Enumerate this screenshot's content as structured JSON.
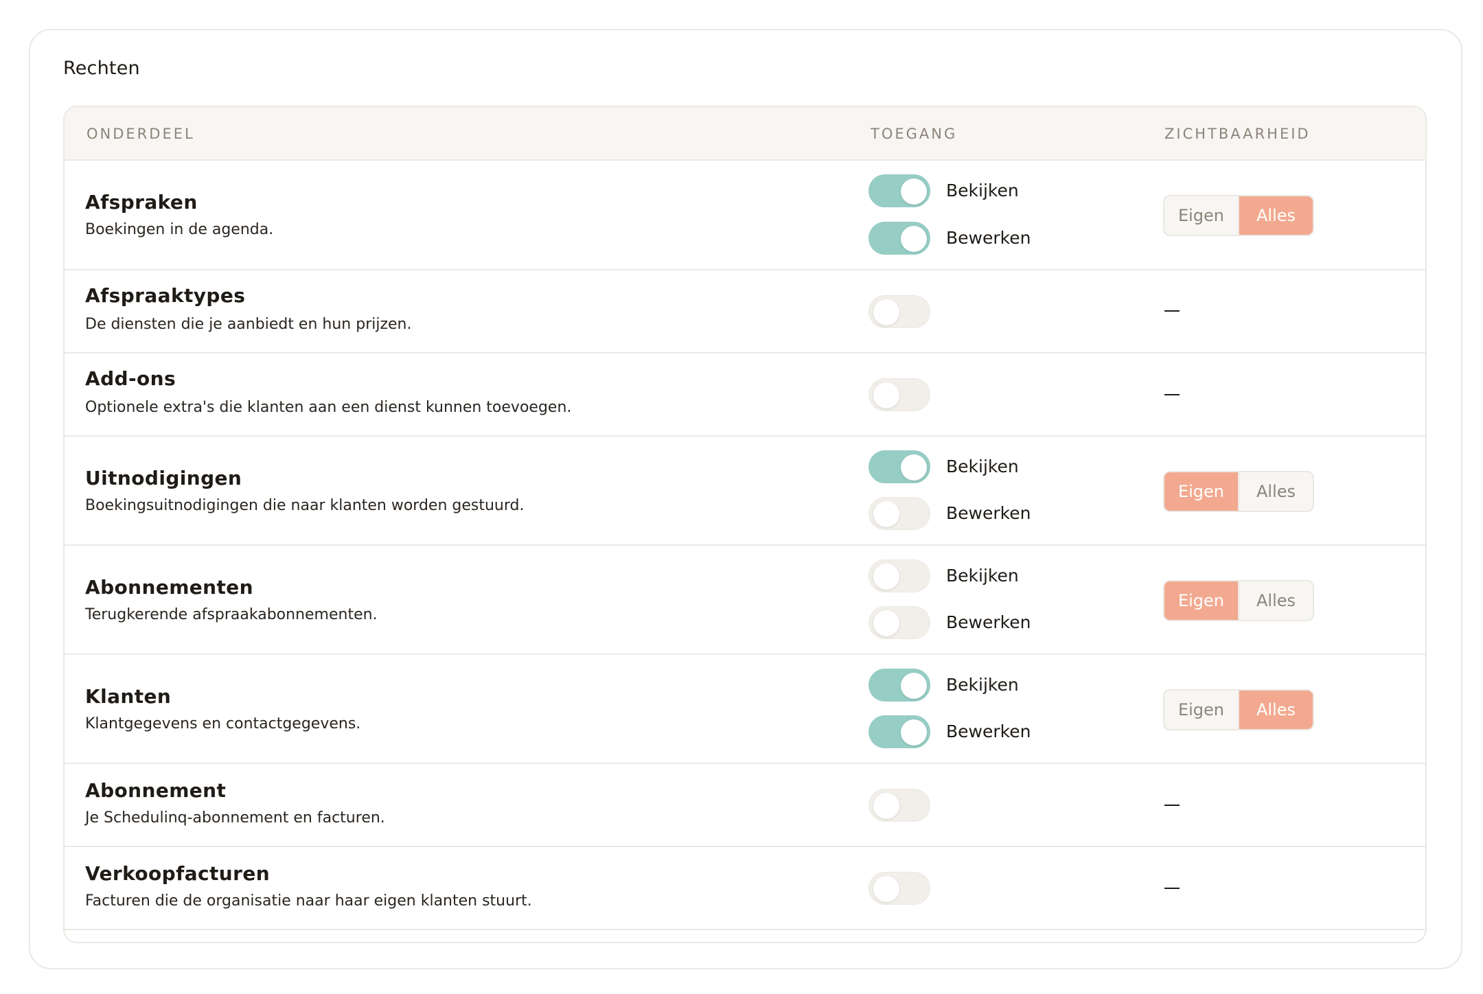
{
  "card": {
    "title": "Rechten"
  },
  "columns": {
    "section": "ONDERDEEL",
    "access": "TOEGANG",
    "visibility": "ZICHTBAARHEID"
  },
  "colors": {
    "toggle_on": "#96cdc5",
    "toggle_off": "#f2efea",
    "segment_active": "#f2a98f",
    "border": "#ebe8e3"
  },
  "labels": {
    "view": "Bekijken",
    "edit": "Bewerken",
    "own": "Eigen",
    "all": "Alles",
    "none": "—"
  },
  "rows": [
    {
      "title": "Afspraken",
      "desc": "Boekingen in de agenda.",
      "toggles": [
        true,
        true
      ],
      "visibility": "Alles"
    },
    {
      "title": "Afspraaktypes",
      "desc": "De diensten die je aanbiedt en hun prijzen.",
      "toggles": [
        false
      ],
      "visibility": null
    },
    {
      "title": "Add-ons",
      "desc": "Optionele extra's die klanten aan een dienst kunnen toevoegen.",
      "toggles": [
        false
      ],
      "visibility": null
    },
    {
      "title": "Uitnodigingen",
      "desc": "Boekingsuitnodigingen die naar klanten worden gestuurd.",
      "toggles": [
        true,
        false
      ],
      "visibility": "Eigen"
    },
    {
      "title": "Abonnementen",
      "desc": "Terugkerende afspraakabonnementen.",
      "toggles": [
        false,
        false
      ],
      "visibility": "Eigen"
    },
    {
      "title": "Klanten",
      "desc": "Klantgegevens en contactgegevens.",
      "toggles": [
        true,
        true
      ],
      "visibility": "Alles"
    },
    {
      "title": "Abonnement",
      "desc": "Je Schedulinq-abonnement en facturen.",
      "toggles": [
        false
      ],
      "visibility": null
    },
    {
      "title": "Verkoopfacturen",
      "desc": "Facturen die de organisatie naar haar eigen klanten stuurt.",
      "toggles": [
        false
      ],
      "visibility": null
    }
  ]
}
